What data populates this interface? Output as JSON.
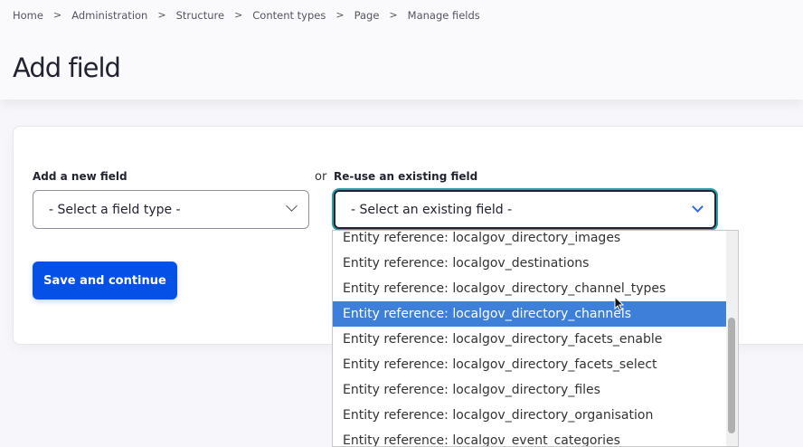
{
  "breadcrumb": [
    "Home",
    "Administration",
    "Structure",
    "Content types",
    "Page",
    "Manage fields"
  ],
  "page_title": "Add field",
  "form": {
    "new_field_label": "Add a new field",
    "new_field_value": "- Select a field type -",
    "or_label": "or",
    "existing_field_label": "Re-use an existing field",
    "existing_field_value": "- Select an existing field -",
    "save_label": "Save and continue"
  },
  "dropdown": {
    "items": [
      "Entity reference: localgov_directory_images",
      "Entity reference: localgov_destinations",
      "Entity reference: localgov_directory_channel_types",
      "Entity reference: localgov_directory_channels",
      "Entity reference: localgov_directory_facets_enable",
      "Entity reference: localgov_directory_facets_select",
      "Entity reference: localgov_directory_files",
      "Entity reference: localgov_directory_organisation",
      "Entity reference: localgov_event_categories"
    ],
    "highlighted_index": 3,
    "scroll_position": 0.55
  }
}
